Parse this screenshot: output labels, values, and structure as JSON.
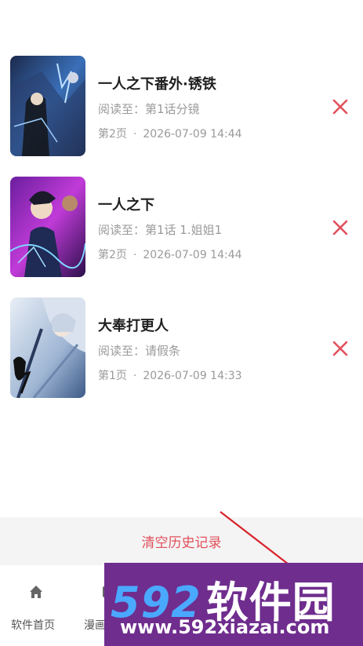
{
  "history": {
    "items": [
      {
        "title": "一人之下番外·锈铁",
        "progress": "阅读至：第1话分镜",
        "page": "第2页",
        "time": "2026-07-09 14:44"
      },
      {
        "title": "一人之下",
        "progress": "阅读至：第1话 1.姐姐1",
        "page": "第2页",
        "time": "2026-07-09 14:44"
      },
      {
        "title": "大奉打更人",
        "progress": "阅读至：请假条",
        "page": "第1页",
        "time": "2026-07-09 14:33"
      }
    ],
    "dot": "·"
  },
  "clear_button": {
    "label": "清空历史记录"
  },
  "tabbar": {
    "tabs": [
      {
        "label": "软件首页",
        "icon": "home-icon"
      },
      {
        "label": "漫画",
        "icon": "comic-icon"
      }
    ]
  },
  "watermark": {
    "digits": "592",
    "name": "软件园",
    "url": "www.592xiazai.com"
  },
  "colors": {
    "accent": "#e2505c",
    "watermark_bg": "#6f2d8e"
  }
}
